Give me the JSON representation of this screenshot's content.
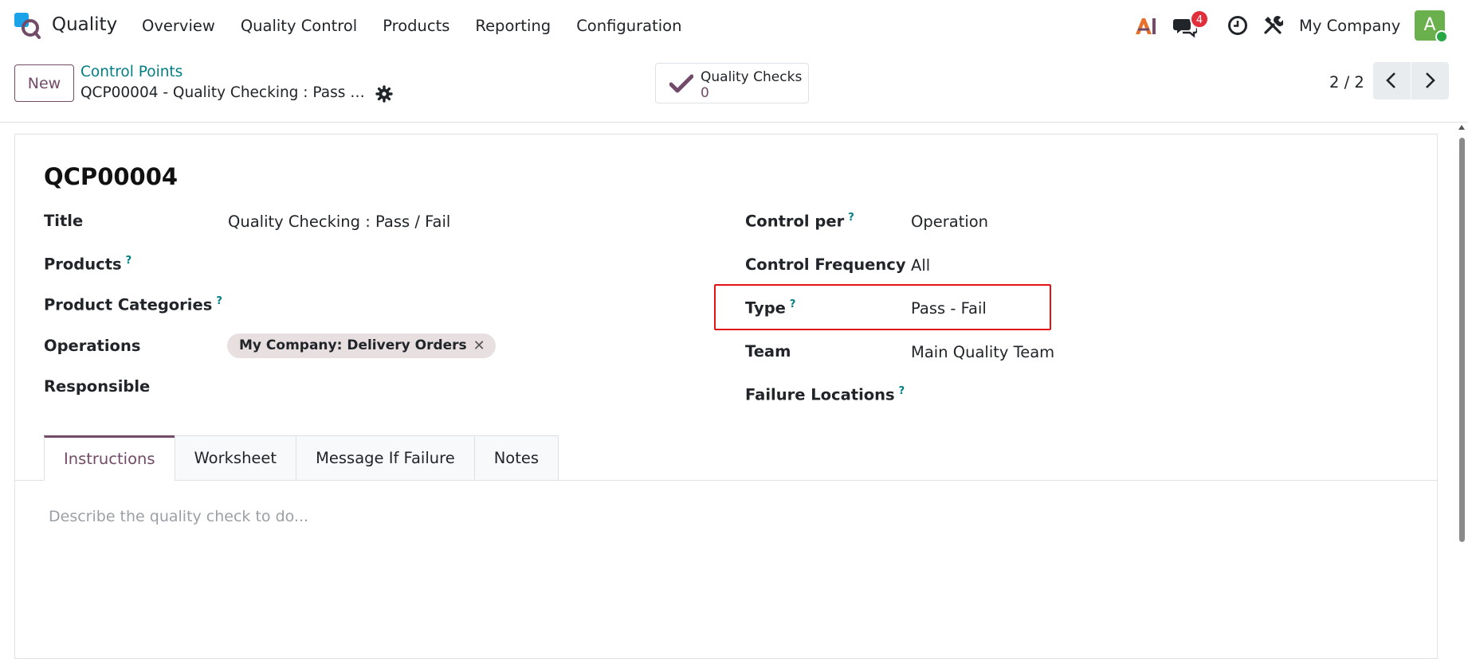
{
  "navbar": {
    "app_name": "Quality",
    "menu": [
      "Overview",
      "Quality Control",
      "Products",
      "Reporting",
      "Configuration"
    ],
    "chat_count": "4",
    "company": "My Company",
    "avatar_letter": "A"
  },
  "control_panel": {
    "new_label": "New",
    "breadcrumb_parent": "Control Points",
    "breadcrumb_current": "QCP00004 - Quality Checking : Pass …",
    "smart_button": {
      "label": "Quality Checks",
      "value": "0"
    },
    "pager": "2 / 2"
  },
  "form": {
    "record_name": "QCP00004",
    "left_fields": {
      "title_label": "Title",
      "title_value": "Quality Checking : Pass / Fail",
      "products_label": "Products",
      "product_categories_label": "Product Categories",
      "operations_label": "Operations",
      "operations_tag": "My Company: Delivery Orders",
      "responsible_label": "Responsible"
    },
    "right_fields": {
      "control_per_label": "Control per",
      "control_per_value": "Operation",
      "control_frequency_label": "Control Frequency",
      "control_frequency_value": "All",
      "type_label": "Type",
      "type_value": "Pass - Fail",
      "team_label": "Team",
      "team_value": "Main Quality Team",
      "failure_locations_label": "Failure Locations"
    },
    "help_mark": "?",
    "tag_close": "✕"
  },
  "tabs": [
    "Instructions",
    "Worksheet",
    "Message If Failure",
    "Notes"
  ],
  "editor": {
    "placeholder": "Describe the quality check to do..."
  },
  "colors": {
    "brand": "#714b67",
    "link": "#017e84",
    "highlight": "#e41313",
    "badge": "#e02e3b"
  }
}
